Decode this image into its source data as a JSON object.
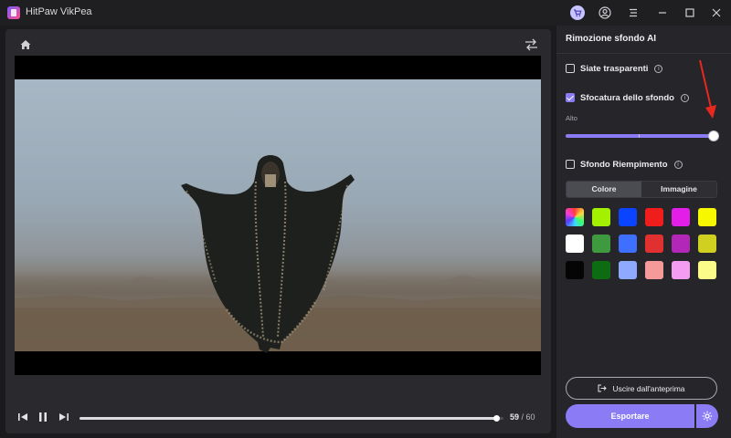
{
  "window": {
    "title": "HitPaw VikPea"
  },
  "player": {
    "current_frame": "59",
    "frame_separator": "/ 60",
    "progress": 0.983
  },
  "panel": {
    "title": "Rimozione sfondo AI",
    "option_transparent": {
      "label": "Siate trasparenti",
      "checked": false
    },
    "option_blur": {
      "label": "Sfocatura dello sfondo",
      "checked": true
    },
    "blur_level_label": "Alto",
    "blur_level": 1.0,
    "option_fill": {
      "label": "Sfondo Riempimento",
      "checked": false
    },
    "tabs": [
      "Colore",
      "Immagine"
    ],
    "active_tab": "Colore",
    "swatch_colors": [
      "gradient",
      "#a3f000",
      "#0a44ff",
      "#f01d1d",
      "#e21ee8",
      "#f7f700",
      "#ffffff",
      "#3f9a3f",
      "#3e6fff",
      "#e03030",
      "#b227b8",
      "#d0d021",
      "#050505",
      "#0d6b11",
      "#8fa9ff",
      "#f59a98",
      "#f39cf2",
      "#fbfb8a"
    ],
    "exit_preview_label": "Uscire dall'anteprima",
    "export_label": "Esportare"
  },
  "colors": {
    "accent": "#8b7cf6",
    "annotation_arrow": "#e8281e"
  }
}
